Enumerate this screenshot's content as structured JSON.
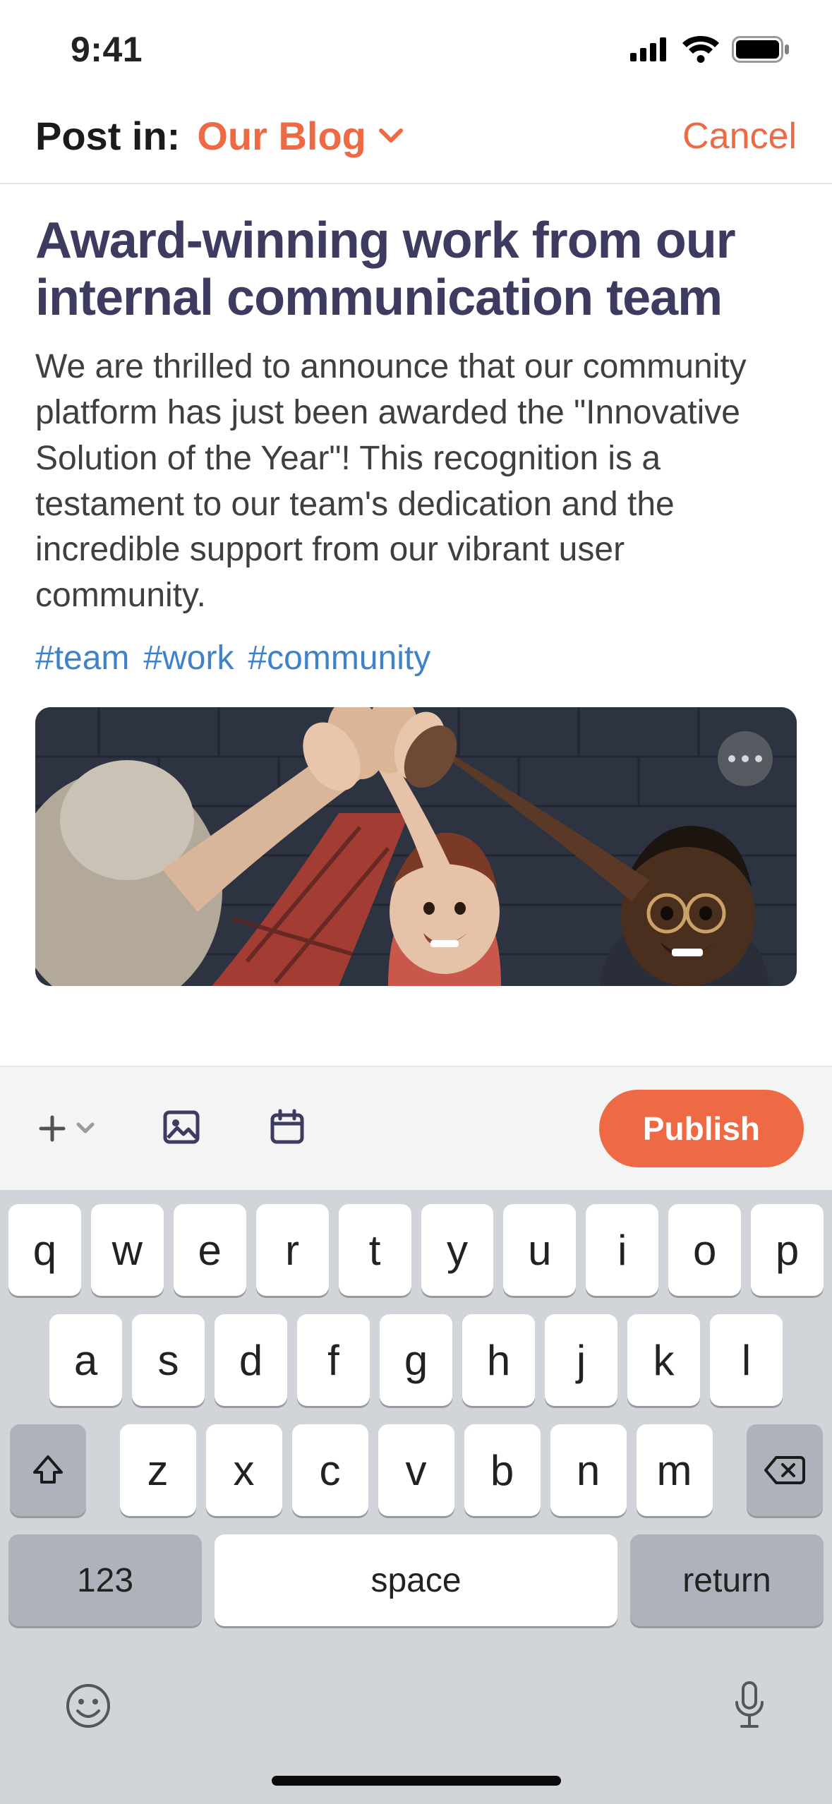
{
  "status": {
    "time": "9:41"
  },
  "header": {
    "post_in_label": "Post in:",
    "blog_name": "Our Blog",
    "cancel_label": "Cancel"
  },
  "content": {
    "title": "Award-winning work from our internal communication team",
    "body": "We are thrilled to announce that our community platform has just been awarded the \"Innovative Solution of the Year\"! This recognition is a testament to our team's dedication and the incredible support from our vibrant user community.",
    "hashtags": [
      "#team",
      "#work",
      "#community"
    ]
  },
  "toolbar": {
    "publish_label": "Publish"
  },
  "keyboard": {
    "row1": [
      "q",
      "w",
      "e",
      "r",
      "t",
      "y",
      "u",
      "i",
      "o",
      "p"
    ],
    "row2": [
      "a",
      "s",
      "d",
      "f",
      "g",
      "h",
      "j",
      "k",
      "l"
    ],
    "row3": [
      "z",
      "x",
      "c",
      "v",
      "b",
      "n",
      "m"
    ],
    "numeric_label": "123",
    "space_label": "space",
    "return_label": "return"
  },
  "colors": {
    "accent": "#ee6a45",
    "title": "#3d3b60",
    "link": "#3f82c8"
  }
}
